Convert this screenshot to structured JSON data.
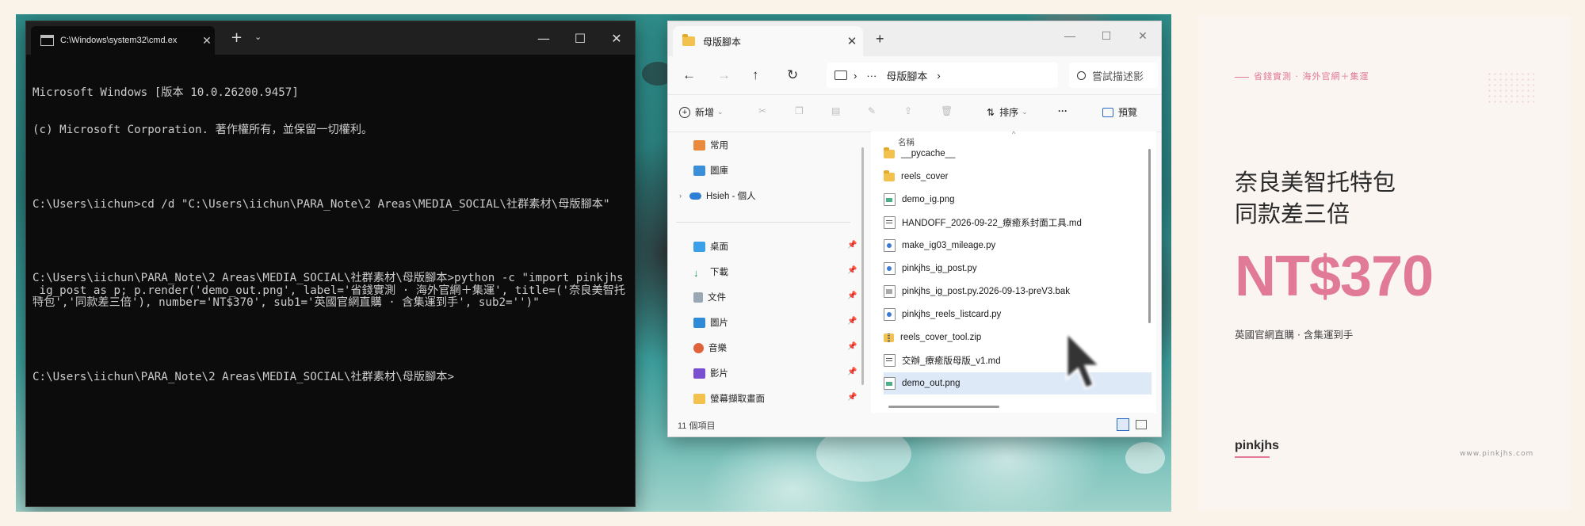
{
  "cmd": {
    "tab_title": "C:\\Windows\\system32\\cmd.ex",
    "close_glyph": "✕",
    "new_tab_glyph": "+",
    "dropdown_glyph": "⌄",
    "minimize_glyph": "—",
    "maximize_glyph": "☐",
    "window_close_glyph": "✕",
    "lines": [
      "Microsoft Windows [版本 10.0.26200.9457]",
      "(c) Microsoft Corporation. 著作權所有，並保留一切權利。",
      "",
      "C:\\Users\\iichun>cd /d \"C:\\Users\\iichun\\PARA_Note\\2 Areas\\MEDIA_SOCIAL\\社群素材\\母版腳本\"",
      "",
      "C:\\Users\\iichun\\PARA_Note\\2 Areas\\MEDIA_SOCIAL\\社群素材\\母版腳本>python -c \"import pinkjhs_ig_post as p; p.render('demo_out.png', label='省錢實測 · 海外官網＋集運', title=('奈良美智托特包','同款差三倍'), number='NT$370', sub1='英國官網直購 · 含集運到手', sub2='')\"",
      "",
      "C:\\Users\\iichun\\PARA_Note\\2 Areas\\MEDIA_SOCIAL\\社群素材\\母版腳本>"
    ]
  },
  "explorer": {
    "tab_title": "母版腳本",
    "close_glyph": "✕",
    "new_tab_glyph": "+",
    "minimize_glyph": "—",
    "maximize_glyph": "☐",
    "window_close_glyph": "✕",
    "back_glyph": "←",
    "forward_glyph": "→",
    "up_glyph": "↑",
    "refresh_glyph": "↻",
    "address": {
      "more_glyph": "···",
      "separator": "›",
      "current": "母版腳本"
    },
    "search_placeholder": "嘗試描述影",
    "toolbar": {
      "new_label": "新增",
      "sort_label": "排序",
      "more_glyph": "···",
      "preview_label": "預覽"
    },
    "nav_top": [
      {
        "label": "常用"
      },
      {
        "label": "圖庫"
      },
      {
        "label": "Hsieh - 個人"
      }
    ],
    "nav_pinned": [
      {
        "label": "桌面"
      },
      {
        "label": "下載"
      },
      {
        "label": "文件"
      },
      {
        "label": "圖片"
      },
      {
        "label": "音樂"
      },
      {
        "label": "影片"
      },
      {
        "label": "螢幕擷取畫面"
      }
    ],
    "column_name": "名稱",
    "files": [
      {
        "name": "__pycache__",
        "type": "folder"
      },
      {
        "name": "reels_cover",
        "type": "folder"
      },
      {
        "name": "demo_ig.png",
        "type": "png"
      },
      {
        "name": "HANDOFF_2026-09-22_療癒系封面工具.md",
        "type": "md"
      },
      {
        "name": "make_ig03_mileage.py",
        "type": "py"
      },
      {
        "name": "pinkjhs_ig_post.py",
        "type": "py"
      },
      {
        "name": "pinkjhs_ig_post.py.2026-09-13-preV3.bak",
        "type": "bak"
      },
      {
        "name": "pinkjhs_reels_listcard.py",
        "type": "py"
      },
      {
        "name": "reels_cover_tool.zip",
        "type": "zip"
      },
      {
        "name": "交辦_療癒版母版_v1.md",
        "type": "md"
      },
      {
        "name": "demo_out.png",
        "type": "png",
        "selected": true
      }
    ],
    "status": "11 個項目"
  },
  "card": {
    "label": "省錢實測 · 海外官網＋集運",
    "title_line1": "奈良美智托特包",
    "title_line2": "同款差三倍",
    "number": "NT$370",
    "sub1": "英國官網直購 · 含集運到手",
    "brand": "pinkjhs",
    "url": "www.pinkjhs.com"
  },
  "colors": {
    "accent_pink": "#e07a96",
    "cmd_background": "#0c0c0c",
    "card_background": "#fbf5f2",
    "selection": "#dde9f7"
  }
}
